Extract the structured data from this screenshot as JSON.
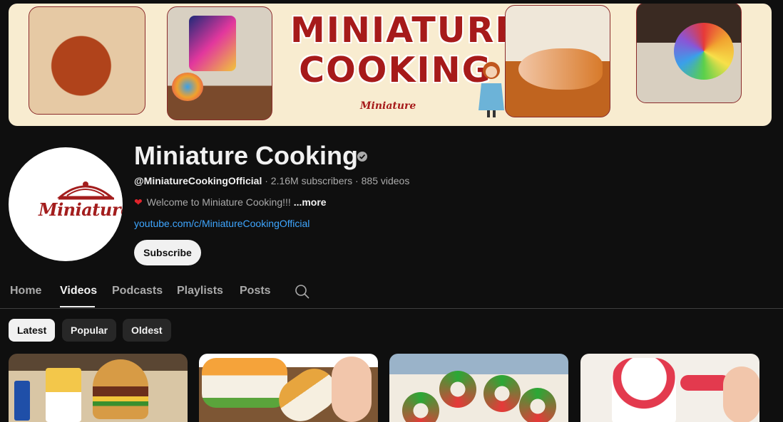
{
  "banner": {
    "title_line1": "MINIATURE",
    "title_line2": "COOKING",
    "logo_text": "Miniature"
  },
  "channel": {
    "avatar_text": "Miniature",
    "name": "Miniature Cooking",
    "handle": "@MiniatureCookingOfficial",
    "separator": " · ",
    "subscribers": "2.16M subscribers",
    "videos": "885 videos",
    "description": "Welcome to Miniature Cooking!!!",
    "more_label": "...more",
    "link": "youtube.com/c/MiniatureCookingOfficial",
    "subscribe_label": "Subscribe"
  },
  "tabs": [
    {
      "label": "Home"
    },
    {
      "label": "Videos"
    },
    {
      "label": "Podcasts"
    },
    {
      "label": "Playlists"
    },
    {
      "label": "Posts"
    }
  ],
  "active_tab": "Videos",
  "filters": [
    {
      "label": "Latest"
    },
    {
      "label": "Popular"
    },
    {
      "label": "Oldest"
    }
  ],
  "active_filter": "Latest",
  "colors": {
    "background": "#0f0f0f",
    "brand_red": "#a61a1a",
    "link_blue": "#3ea6ff",
    "heart_red": "#e1242b"
  },
  "icons": [
    "verified-badge-icon",
    "heart-icon",
    "search-icon",
    "cloche-icon"
  ]
}
